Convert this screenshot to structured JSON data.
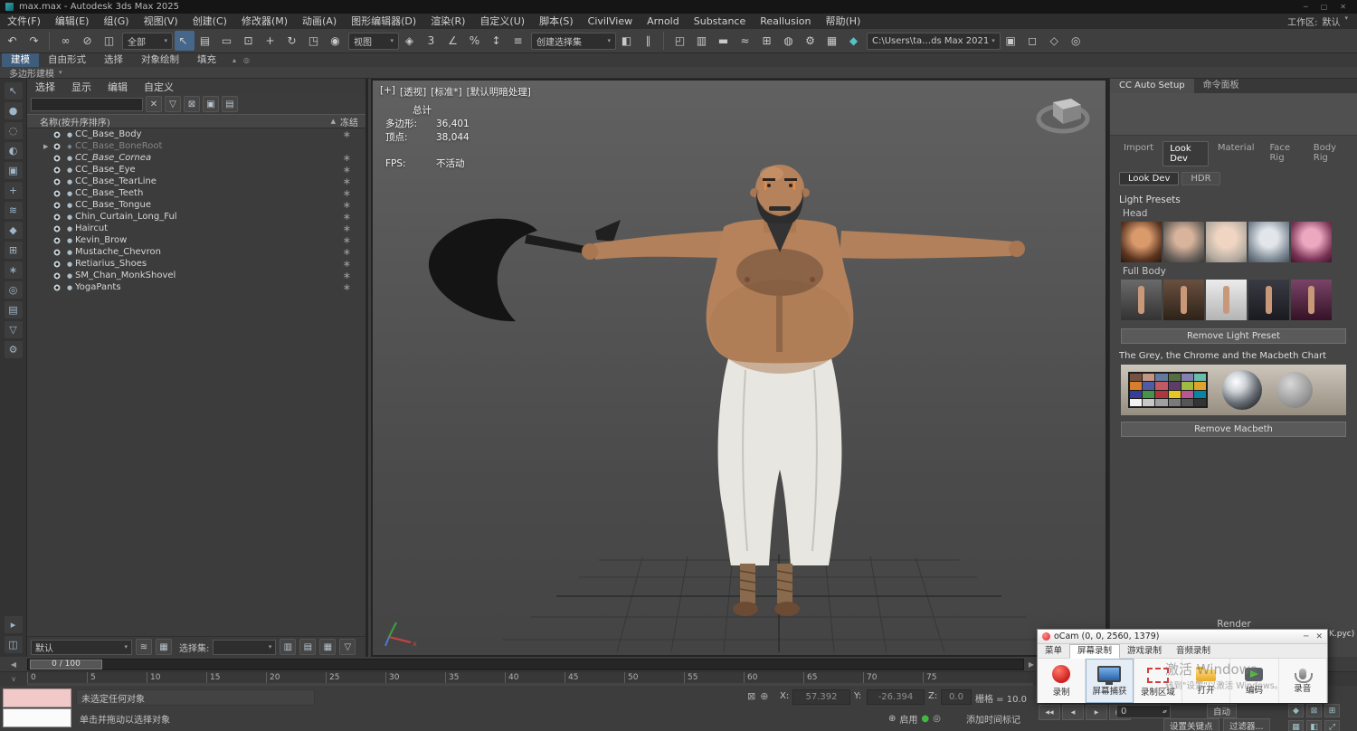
{
  "titlebar": {
    "title": "max.max - Autodesk 3ds Max 2025",
    "minimize": "─",
    "maximize": "▢",
    "close": "✕",
    "workspace_label": "工作区:",
    "workspace_value": "默认",
    "workspace_arrow": "▾"
  },
  "menubar": {
    "items": [
      "文件(F)",
      "编辑(E)",
      "组(G)",
      "视图(V)",
      "创建(C)",
      "修改器(M)",
      "动画(A)",
      "图形编辑器(D)",
      "渲染(R)",
      "自定义(U)",
      "脚本(S)",
      "CivilView",
      "Arnold",
      "Substance",
      "Reallusion",
      "帮助(H)"
    ]
  },
  "toolbar": {
    "items": [
      {
        "name": "undo-icon",
        "glyph": "↶"
      },
      {
        "name": "redo-icon",
        "glyph": "↷"
      },
      {
        "name": "separator",
        "class": "sep"
      },
      {
        "name": "select-and-link-icon",
        "glyph": "∞"
      },
      {
        "name": "unlink-selection-icon",
        "glyph": "⊘"
      },
      {
        "name": "bind-to-space-warp-icon",
        "glyph": "◫"
      },
      {
        "name": "selection-filter-combo",
        "class": "combo",
        "label": "全部",
        "arrow": "▾"
      },
      {
        "name": "select-object-icon",
        "glyph": "↖",
        "class": "active"
      },
      {
        "name": "select-by-name-icon",
        "glyph": "▤"
      },
      {
        "name": "rectangular-selection-icon",
        "glyph": "▭"
      },
      {
        "name": "window-crossing-icon",
        "glyph": "⊡"
      },
      {
        "name": "select-and-move-icon",
        "glyph": "+"
      },
      {
        "name": "select-and-rotate-icon",
        "glyph": "↻"
      },
      {
        "name": "select-and-scale-icon",
        "glyph": "◳"
      },
      {
        "name": "select-and-place-icon",
        "glyph": "◉"
      },
      {
        "name": "view-combo",
        "class": "combo",
        "label": "视图",
        "arrow": "▾"
      },
      {
        "name": "pivot-icon",
        "glyph": "◈"
      },
      {
        "name": "snaps-toggle-icon",
        "glyph": "3"
      },
      {
        "name": "angle-snap-icon",
        "glyph": "∠"
      },
      {
        "name": "percent-snap-icon",
        "glyph": "%"
      },
      {
        "name": "spinner-snap-icon",
        "glyph": "↕"
      },
      {
        "name": "named-selection-sets-icon",
        "glyph": "≡"
      },
      {
        "name": "named-selection-combo",
        "class": "combo wide",
        "label": "创建选择集",
        "arrow": "▾"
      },
      {
        "name": "mirror-icon",
        "glyph": "◧"
      },
      {
        "name": "align-icon",
        "glyph": "∥"
      },
      {
        "name": "separator",
        "class": "sep"
      },
      {
        "name": "scene-explorer-toggle-icon",
        "glyph": "◰"
      },
      {
        "name": "layer-explorer-icon",
        "glyph": "▥"
      },
      {
        "name": "ribbon-toggle-icon",
        "glyph": "▬"
      },
      {
        "name": "curve-editor-icon",
        "glyph": "≈"
      },
      {
        "name": "schematic-view-icon",
        "glyph": "⊞"
      },
      {
        "name": "material-editor-icon",
        "glyph": "◍"
      },
      {
        "name": "render-setup-icon",
        "glyph": "⚙"
      },
      {
        "name": "rendered-frame-icon",
        "glyph": "▦"
      },
      {
        "name": "render-icon",
        "glyph": "◆",
        "class": "teal"
      },
      {
        "name": "project-path-combo",
        "class": "combo path",
        "label": "C:\\Users\\ta…ds Max 2021",
        "arrow": "▾"
      },
      {
        "name": "project-folder-icon",
        "glyph": "▣"
      },
      {
        "name": "workspace-icon-1",
        "glyph": "◻"
      },
      {
        "name": "workspace-icon-2",
        "glyph": "◇"
      },
      {
        "name": "help-search-icon",
        "glyph": "◎"
      }
    ]
  },
  "ribbon": {
    "tabs": [
      {
        "label": "建模",
        "class": "active"
      },
      {
        "label": "自由形式"
      },
      {
        "label": "选择"
      },
      {
        "label": "对象绘制"
      },
      {
        "label": "填充"
      }
    ],
    "collapse_arrow": "▴",
    "pin_icon": "◎",
    "panel_label": "多边形建模",
    "panel_arrow": "▾"
  },
  "left_strip": {
    "icons": [
      {
        "name": "strip-select-icon",
        "glyph": "↖"
      },
      {
        "name": "strip-geometry-icon",
        "glyph": "●"
      },
      {
        "name": "strip-shapes-icon",
        "glyph": "◌"
      },
      {
        "name": "strip-lights-icon",
        "glyph": "◐"
      },
      {
        "name": "strip-cameras-icon",
        "glyph": "▣"
      },
      {
        "name": "strip-helpers-icon",
        "glyph": "+"
      },
      {
        "name": "strip-spacewarps-icon",
        "glyph": "≋"
      },
      {
        "name": "strip-bones-icon",
        "glyph": "◆"
      },
      {
        "name": "strip-groups-icon",
        "glyph": "⊞"
      },
      {
        "name": "strip-frozen-icon",
        "glyph": "∗"
      },
      {
        "name": "strip-hidden-icon",
        "glyph": "◎"
      },
      {
        "name": "strip-sort-icon",
        "glyph": "▤"
      },
      {
        "name": "strip-filter-icon",
        "glyph": "▽"
      },
      {
        "name": "strip-settings-icon",
        "glyph": "⚙"
      }
    ],
    "bottom_icons": [
      {
        "name": "strip-expand-icon",
        "glyph": "▸"
      },
      {
        "name": "strip-pin-icon",
        "glyph": "◫"
      }
    ]
  },
  "explorer": {
    "menu": [
      "选择",
      "显示",
      "编辑",
      "自定义"
    ],
    "clear_icon": "✕",
    "tool_icons": [
      {
        "name": "filter-funnel-icon",
        "glyph": "▽"
      },
      {
        "name": "lock-explorer-icon",
        "glyph": "⊠"
      },
      {
        "name": "pick-parent-icon",
        "glyph": "▣"
      },
      {
        "name": "list-view-icon",
        "glyph": "▤"
      }
    ],
    "header": {
      "name_col": "名称(按升序排序)",
      "sort_arrow": "▲",
      "frozen_col": "冻结"
    },
    "items": [
      {
        "label": "CC_Base_Body",
        "icon": "●",
        "frozen": "∗"
      },
      {
        "label": "CC_Base_BoneRoot",
        "icon": "◆",
        "class": "dim",
        "expander": "▶",
        "frozen": ""
      },
      {
        "label": "CC_Base_Cornea",
        "icon": "●",
        "class": "italic",
        "frozen": "∗"
      },
      {
        "label": "CC_Base_Eye",
        "icon": "●",
        "frozen": "∗"
      },
      {
        "label": "CC_Base_TearLine",
        "icon": "●",
        "frozen": "∗"
      },
      {
        "label": "CC_Base_Teeth",
        "icon": "●",
        "frozen": "∗"
      },
      {
        "label": "CC_Base_Tongue",
        "icon": "●",
        "frozen": "∗"
      },
      {
        "label": "Chin_Curtain_Long_Ful",
        "icon": "●",
        "frozen": "∗"
      },
      {
        "label": "Haircut",
        "icon": "●",
        "frozen": "∗"
      },
      {
        "label": "Kevin_Brow",
        "icon": "●",
        "frozen": "∗"
      },
      {
        "label": "Mustache_Chevron",
        "icon": "●",
        "frozen": "∗"
      },
      {
        "label": "Retiarius_Shoes",
        "icon": "●",
        "frozen": "∗"
      },
      {
        "label": "SM_Chan_MonkShovel",
        "icon": "●",
        "frozen": "∗"
      },
      {
        "label": "YogaPants",
        "icon": "●",
        "frozen": "∗"
      }
    ],
    "footer": {
      "default_combo": "默认",
      "combo_arrow": "▾",
      "icon_1": "≋",
      "icon_2": "▦",
      "sets_label": "选择集:",
      "icon_3": "▥",
      "icon_4": "▤",
      "icon_5": "▦",
      "icon_6": "▽"
    }
  },
  "viewport": {
    "label_parts": [
      "[+]",
      "[透视]",
      "[标准*]",
      "[默认明暗处理]"
    ],
    "stats": {
      "total": "总计",
      "polys_label": "多边形:",
      "polys_value": "36,401",
      "verts_label": "顶点:",
      "verts_value": "38,044",
      "fps_label": "FPS:",
      "fps_value": "不活动"
    }
  },
  "cc_panel": {
    "tab_active": "CC Auto Setup",
    "tab_inactive": "命令面板",
    "nav_tabs": [
      {
        "label": "Import"
      },
      {
        "label": "Look Dev",
        "class": "active"
      },
      {
        "label": "Material"
      },
      {
        "label": "Face Rig"
      },
      {
        "label": "Body Rig"
      }
    ],
    "sub_tabs": [
      {
        "label": "Look Dev",
        "class": "active"
      },
      {
        "label": "HDR"
      }
    ],
    "light_presets_title": "Light Presets",
    "head_label": "Head",
    "head_presets": [
      {
        "name": "head-preset-warm"
      },
      {
        "name": "head-preset-neutral"
      },
      {
        "name": "head-preset-bright"
      },
      {
        "name": "head-preset-cool"
      },
      {
        "name": "head-preset-pink"
      }
    ],
    "full_body_label": "Full Body",
    "body_presets": [
      {
        "name": "body-preset-gray"
      },
      {
        "name": "body-preset-warm"
      },
      {
        "name": "body-preset-bright"
      },
      {
        "name": "body-preset-dark"
      },
      {
        "name": "body-preset-pink"
      }
    ],
    "remove_light_button": "Remove Light Preset",
    "macbeth_title": "The Grey, the Chrome and the Macbeth Chart",
    "macbeth_colors": [
      {
        "color": "#735244"
      },
      {
        "color": "#c29682"
      },
      {
        "color": "#627a9d"
      },
      {
        "color": "#576c43"
      },
      {
        "color": "#8580b1"
      },
      {
        "color": "#67bdaa"
      },
      {
        "color": "#d67e2c"
      },
      {
        "color": "#505ba6"
      },
      {
        "color": "#c15a63"
      },
      {
        "color": "#5e3c6c"
      },
      {
        "color": "#9dbc40"
      },
      {
        "color": "#e0a32e"
      },
      {
        "color": "#383d96"
      },
      {
        "color": "#469449"
      },
      {
        "color": "#af363c"
      },
      {
        "color": "#e7c71f"
      },
      {
        "color": "#bb5695"
      },
      {
        "color": "#0885a1"
      },
      {
        "color": "#f3f3f2"
      },
      {
        "color": "#c8c8c8"
      },
      {
        "color": "#a0a0a0"
      },
      {
        "color": "#7a7a7a"
      },
      {
        "color": "#555555"
      },
      {
        "color": "#343434"
      }
    ],
    "remove_macbeth_button": "Remove Macbeth",
    "render_label": "Render",
    "path_fragment": "K.pyc)"
  },
  "timeline": {
    "left_arrow": "◀",
    "right_arrow": "▶",
    "slider_value": "0 / 100",
    "ruler_toggle": "∨",
    "ticks": [
      "0",
      "5",
      "10",
      "15",
      "20",
      "25",
      "30",
      "35",
      "40",
      "45",
      "50",
      "55",
      "60",
      "65",
      "70",
      "75"
    ]
  },
  "statusbar": {
    "selection_status": "未选定任何对象",
    "prompt": "单击并拖动以选择对象",
    "lock_icon": "⊠",
    "offset_icon": "⊕",
    "x_label": "X:",
    "x_value": "57.392",
    "y_label": "Y:",
    "y_value": "-26.394",
    "z_label": "Z:",
    "z_value": "0.0",
    "grid_label": "栅格 = 10.0",
    "enable_icon": "⊕",
    "enable_label": "启用",
    "status_dot": "●",
    "status_ring": "◎",
    "add_marker": "添加时间标记",
    "transport": [
      {
        "name": "go-to-start-button",
        "glyph": "◀◀"
      },
      {
        "name": "prev-frame-button",
        "glyph": "◀"
      },
      {
        "name": "play-button",
        "glyph": "▶"
      },
      {
        "name": "next-key-button",
        "glyph": "▶▶"
      }
    ],
    "frame_field": "0",
    "auto_key": "自动",
    "set_key": "设置关键点",
    "key_filters": "过滤器...",
    "corner_icons": [
      {
        "name": "render-teapot-icon",
        "glyph": "◆"
      },
      {
        "name": "lock-toggle-icon",
        "glyph": "⊠"
      },
      {
        "name": "grid-toggle-icon",
        "glyph": "⊞"
      },
      {
        "name": "snapshot-icon",
        "glyph": "▦"
      },
      {
        "name": "viewport-layout-icon",
        "glyph": "◧"
      },
      {
        "name": "fullscreen-icon",
        "glyph": "⤢"
      }
    ]
  },
  "ocam": {
    "title": "oCam (0, 0, 2560, 1379)",
    "minimize": "─",
    "close": "✕",
    "menu_items": [
      {
        "label": "菜单",
        "name": "ocam-menu-button"
      },
      {
        "label": "屏幕录制",
        "name": "ocam-tab-screen-record",
        "class": "active"
      },
      {
        "label": "游戏录制",
        "name": "ocam-tab-game-record"
      },
      {
        "label": "音频录制",
        "name": "ocam-tab-audio-record"
      }
    ],
    "buttons": [
      {
        "label": "录制",
        "name": "ocam-record-button",
        "class": "ic-record"
      },
      {
        "label": "屏幕捕获",
        "name": "ocam-screen-capture-button",
        "class": "ic-monitor pressed"
      },
      {
        "label": "录制区域",
        "name": "ocam-record-area-button",
        "class": "ic-region"
      },
      {
        "label": "打开",
        "name": "ocam-open-button",
        "class": "ic-folder"
      },
      {
        "label": "编码",
        "name": "ocam-encode-button",
        "class": "ic-encode"
      },
      {
        "label": "录音",
        "name": "ocam-audio-button",
        "class": "ic-mic"
      }
    ]
  },
  "watermark": {
    "line1": "激活 Windows",
    "line2": "转到\"设置\"以激活 Windows。"
  }
}
